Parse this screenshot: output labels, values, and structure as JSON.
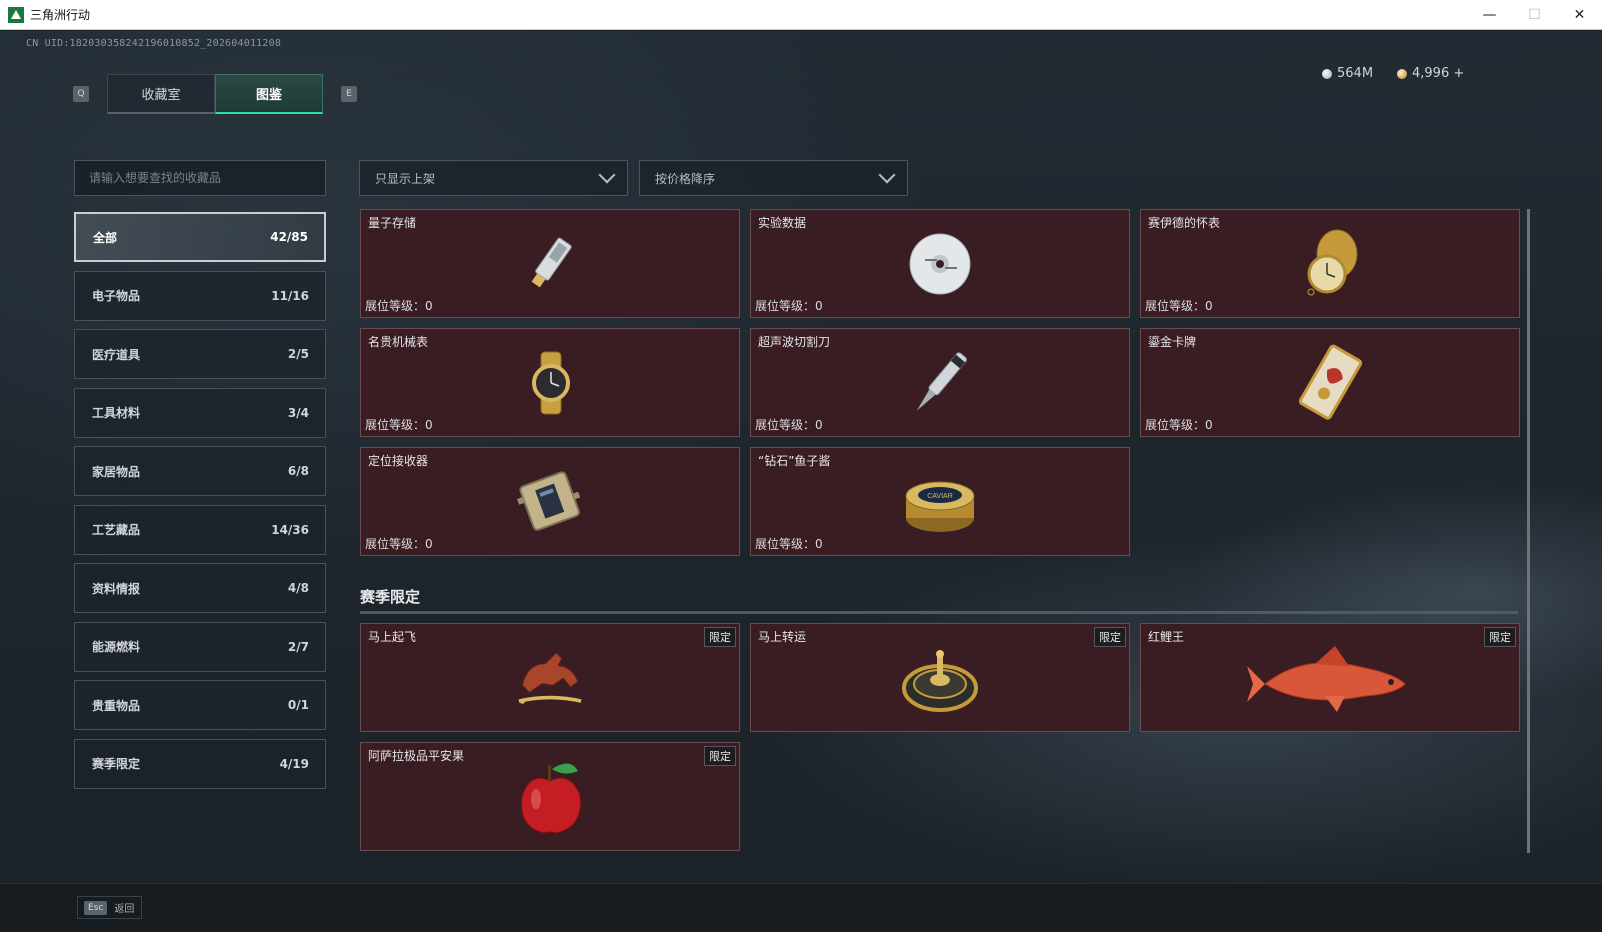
{
  "window": {
    "title": "三角洲行动",
    "minimize": "—",
    "maximize": "☐",
    "close": "✕"
  },
  "uid": "CN UID:182030358242196010852_202604011208",
  "currency": {
    "silver": "564M",
    "gold": "4,996 +"
  },
  "tabs": {
    "prev_key": "Q",
    "next_key": "E",
    "items": [
      {
        "label": "收藏室",
        "active": false
      },
      {
        "label": "图鉴",
        "active": true
      }
    ]
  },
  "search": {
    "placeholder": "请输入想要查找的收藏品"
  },
  "categories": [
    {
      "label": "全部",
      "count": "42/85",
      "active": true
    },
    {
      "label": "电子物品",
      "count": "11/16"
    },
    {
      "label": "医疗道具",
      "count": "2/5"
    },
    {
      "label": "工具材料",
      "count": "3/4"
    },
    {
      "label": "家居物品",
      "count": "6/8"
    },
    {
      "label": "工艺藏品",
      "count": "14/36"
    },
    {
      "label": "资料情报",
      "count": "4/8"
    },
    {
      "label": "能源燃料",
      "count": "2/7"
    },
    {
      "label": "贵重物品",
      "count": "0/1"
    },
    {
      "label": "赛季限定",
      "count": "4/19"
    }
  ],
  "filters": {
    "display": "只显示上架",
    "sort": "按价格降序"
  },
  "items": [
    {
      "name": "量子存储",
      "level_label": "展位等级：",
      "level": "0",
      "icon": "usb-drive-icon"
    },
    {
      "name": "实验数据",
      "level_label": "展位等级：",
      "level": "0",
      "icon": "disc-icon"
    },
    {
      "name": "赛伊德的怀表",
      "level_label": "展位等级：",
      "level": "0",
      "icon": "pocket-watch-icon"
    },
    {
      "name": "名贵机械表",
      "level_label": "展位等级：",
      "level": "0",
      "icon": "wristwatch-icon"
    },
    {
      "name": "超声波切割刀",
      "level_label": "展位等级：",
      "level": "0",
      "icon": "ultrasonic-cutter-icon"
    },
    {
      "name": "鎏金卡牌",
      "level_label": "展位等级：",
      "level": "0",
      "icon": "gilded-card-icon"
    },
    {
      "name": "定位接收器",
      "level_label": "展位等级：",
      "level": "0",
      "icon": "receiver-icon"
    },
    {
      "name": "“钻石”鱼子酱",
      "level_label": "展位等级：",
      "level": "0",
      "icon": "caviar-tin-icon"
    }
  ],
  "season": {
    "title": "赛季限定",
    "limited_label": "限定",
    "items": [
      {
        "name": "马上起飞",
        "icon": "horse-statue-icon"
      },
      {
        "name": "马上转运",
        "icon": "golden-wheel-icon"
      },
      {
        "name": "红鲤王",
        "icon": "red-carp-icon"
      },
      {
        "name": "阿萨拉极品平安果",
        "icon": "red-apple-icon"
      }
    ]
  },
  "caviar_label": "CAVIAR",
  "bottom": {
    "esc_key": "Esc",
    "back_label": "返回"
  }
}
